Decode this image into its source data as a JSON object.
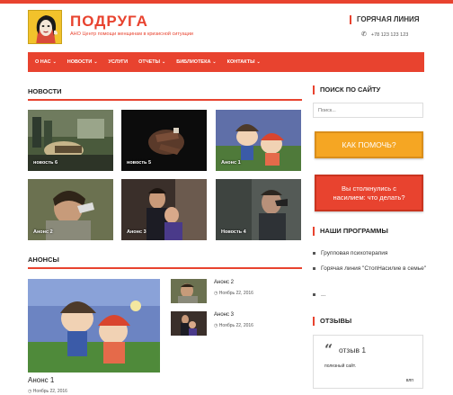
{
  "header": {
    "site_title": "ПОДРУГА",
    "tagline": "АНО Центр помощи женщинам в кризисной ситуации",
    "hotline_title": "ГОРЯЧАЯ ЛИНИЯ",
    "hotline_phone": "+78 123 123 123"
  },
  "nav": {
    "items": [
      {
        "label": "О НАС",
        "chevron": true
      },
      {
        "label": "НОВОСТИ",
        "chevron": true
      },
      {
        "label": "УСЛУГИ",
        "chevron": false
      },
      {
        "label": "ОТЧЕТЫ",
        "chevron": true
      },
      {
        "label": "БИБЛИОТЕКА",
        "chevron": true
      },
      {
        "label": "КОНТАКТЫ",
        "chevron": true
      }
    ]
  },
  "news": {
    "title": "НОВОСТИ",
    "items": [
      {
        "caption": "новость 6"
      },
      {
        "caption": "новость 5"
      },
      {
        "caption": "Анонс 1"
      },
      {
        "caption": "Анонс 2"
      },
      {
        "caption": "Анонс 3"
      },
      {
        "caption": "Новость 4"
      }
    ]
  },
  "announcements": {
    "title": "АНОНСЫ",
    "big": {
      "title": "Анонс 1",
      "date": "Ноябрь 22, 2016"
    },
    "small": [
      {
        "title": "Анонс 2",
        "date": "Ноябрь 22, 2016"
      },
      {
        "title": "Анонс 3",
        "date": "Ноябрь 22, 2016"
      }
    ]
  },
  "sidebar": {
    "search_title": "ПОИСК ПО САЙТУ",
    "search_placeholder": "Поиск...",
    "help_button": "КАК ПОМОЧЬ?",
    "violence_button": "Вы столкнулись с насилием: что делать?",
    "programs_title": "НАШИ ПРОГРАММЫ",
    "programs": [
      "Групповая психотерапия",
      "Горячая линия \"СтопНасилие в семье\"",
      "..."
    ],
    "reviews_title": "ОТЗЫВЫ",
    "review": {
      "quote_mark": "“",
      "title": "отзыв 1",
      "text": "полезный сайт.",
      "author": "влп"
    }
  },
  "colors": {
    "accent": "#e8432f",
    "orange": "#f5a623"
  }
}
